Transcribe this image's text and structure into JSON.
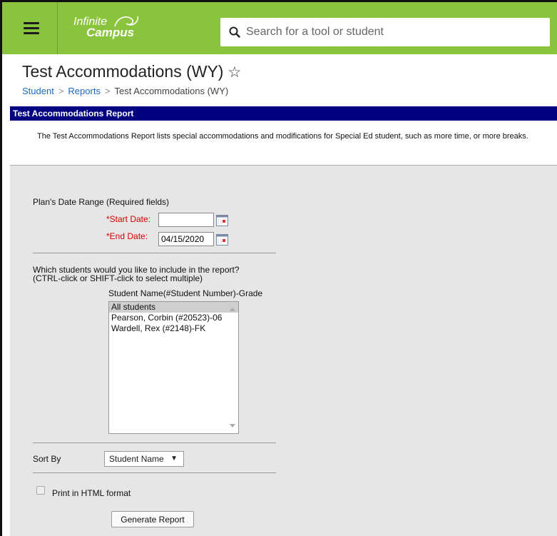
{
  "app": {
    "logo_line1": "Infinite",
    "logo_line2": "Campus",
    "search_placeholder": "Search for a tool or student"
  },
  "page": {
    "title": "Test Accommodations (WY)",
    "breadcrumb": [
      "Student",
      "Reports",
      "Test Accommodations (WY)"
    ]
  },
  "report": {
    "header": "Test Accommodations Report",
    "description": "The Test Accommodations Report lists special accommodations and modifications for Special Ed student, such as more time, or more breaks."
  },
  "form": {
    "date_range_label": "Plan's Date Range (Required fields)",
    "start_date_label": "*Start Date:",
    "start_date_value": "",
    "end_date_label": "*End Date:",
    "end_date_value": "04/15/2020",
    "students_question_line1": "Which students would you like to include in the report?",
    "students_question_line2": "(CTRL-click or SHIFT-click to select multiple)",
    "list_header": "Student Name(#Student Number)-Grade",
    "students": [
      "All students",
      "Pearson, Corbin (#20523)-06",
      "Wardell, Rex (#2148)-FK"
    ],
    "selected_index": 0,
    "sort_by_label": "Sort By",
    "sort_by_value": "Student Name",
    "print_html_label": "Print in HTML format",
    "print_html_checked": false,
    "generate_button": "Generate Report"
  },
  "colors": {
    "topbar": "#8ac43f",
    "report_header": "#000080",
    "required_label": "#d40000",
    "link": "#1a6bbf"
  }
}
